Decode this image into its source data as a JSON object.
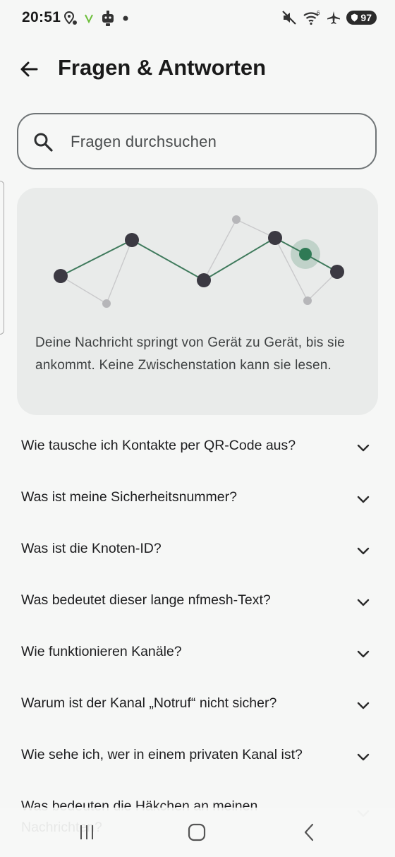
{
  "status_bar": {
    "time": "20:51",
    "battery": "97",
    "icons_left": [
      "location-pin-icon",
      "leaf-icon",
      "robot-icon",
      "dot-icon"
    ],
    "icons_right": [
      "mute-icon",
      "wifi-icon",
      "airplane-icon",
      "battery-badge"
    ]
  },
  "appbar": {
    "title": "Fragen & Antworten",
    "back_icon": "arrow-back-icon"
  },
  "search": {
    "placeholder": "Fragen durchsuchen",
    "value": ""
  },
  "illustration_card": {
    "text": "Deine Nachricht springt von Gerät zu Gerät, bis sie ankommt. Keine Zwischenstation kann sie lesen.",
    "colors": {
      "path": "#3f7a5c",
      "node": "#3b3942",
      "active_node": "#2f7a55",
      "faint_node": "#b6b6b9"
    }
  },
  "faq": {
    "items": [
      "Wie tausche ich Kontakte per QR-Code aus?",
      "Was ist meine Sicherheitsnummer?",
      "Was ist die Knoten-ID?",
      "Was bedeutet dieser lange nfmesh-Text?",
      "Wie funktionieren Kanäle?",
      "Warum ist der Kanal „Notruf“ nicht sicher?",
      "Wie sehe ich, wer in einem privaten Kanal ist?"
    ],
    "last_item": "Was bedeuten die Häkchen an meinen Nachrichten?"
  },
  "nav": {
    "icons": [
      "recent-apps-icon",
      "home-icon",
      "back-icon"
    ]
  }
}
